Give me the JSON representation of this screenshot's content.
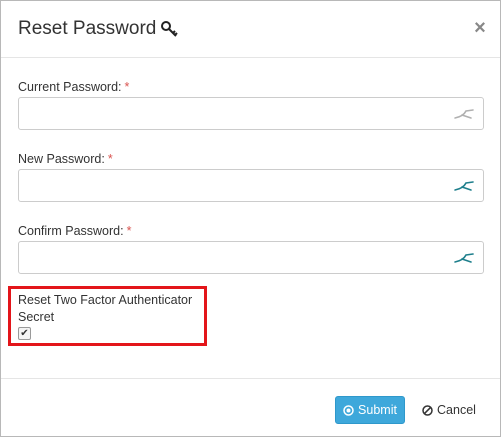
{
  "dialog": {
    "title": "Reset Password",
    "title_icon": "key-icon",
    "close_label": "×"
  },
  "fields": [
    {
      "label": "Current Password:",
      "required_mark": "*",
      "value": "",
      "icon": "password-reveal-icon",
      "icon_color": "#b0b0b0"
    },
    {
      "label": "New Password:",
      "required_mark": "*",
      "value": "",
      "icon": "password-reveal-icon",
      "icon_color": "#1e7f8c"
    },
    {
      "label": "Confirm Password:",
      "required_mark": "*",
      "value": "",
      "icon": "password-reveal-icon",
      "icon_color": "#1e7f8c"
    }
  ],
  "two_factor": {
    "label": "Reset Two Factor Authenticator Secret",
    "checked": true,
    "highlight_color": "#e3151a"
  },
  "footer": {
    "submit_label": "Submit",
    "submit_icon": "circle-dot-icon",
    "submit_color": "#3ea8db",
    "cancel_label": "Cancel",
    "cancel_icon": "ban-icon"
  }
}
